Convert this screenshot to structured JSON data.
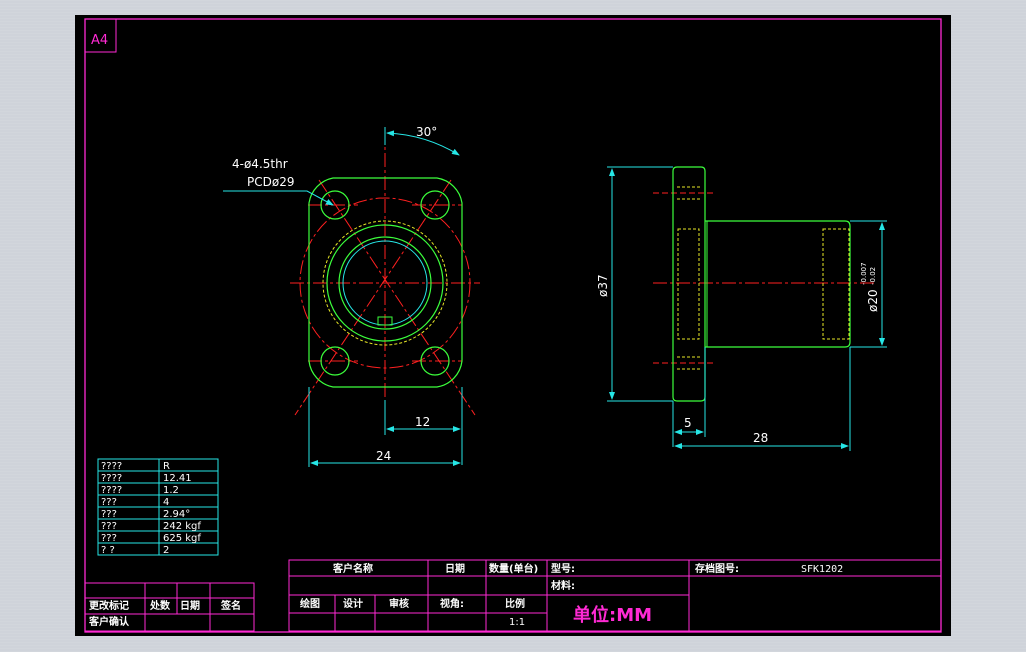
{
  "sheet": {
    "size_label": "A4"
  },
  "front_view": {
    "hole_callout_line1": "4-ø4.5thr",
    "hole_callout_line2": "PCDø29",
    "angle_dim": "30°",
    "dim_half_width": "12",
    "dim_width": "24"
  },
  "side_view": {
    "dim_flange_dia": "ø37",
    "dim_body_dia": "ø20",
    "tol_upper": "-0.007",
    "tol_lower": "-0.02",
    "dim_flange_thk": "5",
    "dim_length": "28"
  },
  "spec_table": {
    "rows": [
      {
        "k": "????",
        "v": "R"
      },
      {
        "k": "????",
        "v": "12.41"
      },
      {
        "k": "????",
        "v": "1.2"
      },
      {
        "k": " ???",
        "v": "4"
      },
      {
        "k": " ???",
        "v": "2.94°"
      },
      {
        "k": " ???",
        "v": "242 kgf"
      },
      {
        "k": " ???",
        "v": "625 kgf"
      },
      {
        "k": " ?  ?",
        "v": "2"
      }
    ]
  },
  "revision_block": {
    "change_mark": "更改标记",
    "location": "处数",
    "date": "日期",
    "signature": "签名",
    "customer_confirm": "客户确认"
  },
  "title_block": {
    "customer_name": "客户名称",
    "date": "日期",
    "quantity": "数量(单台)",
    "model": "型号:",
    "storage_drawing_no": "存档图号:",
    "drawing_no_value": "SFK1202",
    "material": "材料:",
    "drawn": "绘图",
    "design": "设计",
    "review": "审核",
    "view_angle": "视角:",
    "scale": "比例",
    "scale_value": "1:1",
    "unit": "单位:MM"
  },
  "colors": {
    "background": "#000000",
    "frame": "#ff2ad4",
    "outline": "#3cff3c",
    "center_line": "#ff2020",
    "dimension": "#26e6e6",
    "hidden": "#e6e626",
    "text": "#ffffff"
  }
}
